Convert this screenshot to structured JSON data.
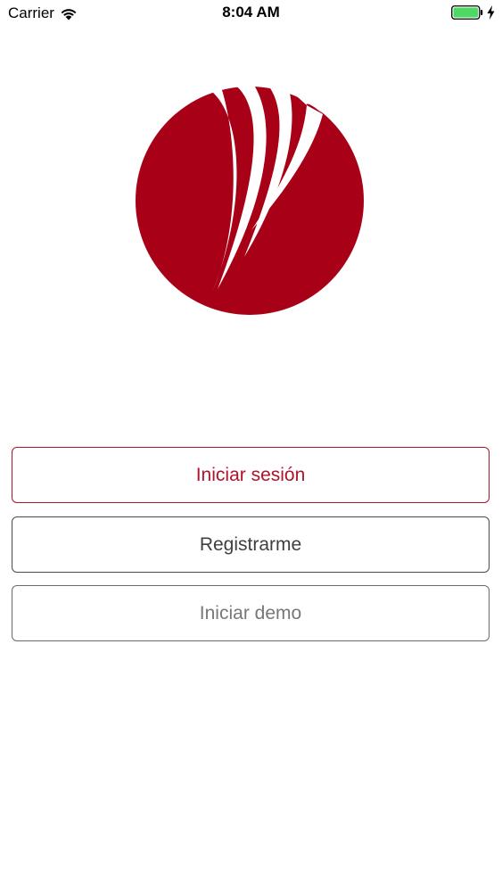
{
  "status_bar": {
    "carrier": "Carrier",
    "time": "8:04 AM",
    "wifi_icon": "wifi-icon",
    "battery_icon": "battery-icon",
    "charging_icon": "charging-bolt-icon",
    "battery_color": "#4cd964"
  },
  "logo": {
    "icon": "brand-logo-icon",
    "color": "#a80016"
  },
  "actions": {
    "login_label": "Iniciar sesión",
    "register_label": "Registrarme",
    "demo_label": "Iniciar demo",
    "login_color": "#b0132b"
  }
}
